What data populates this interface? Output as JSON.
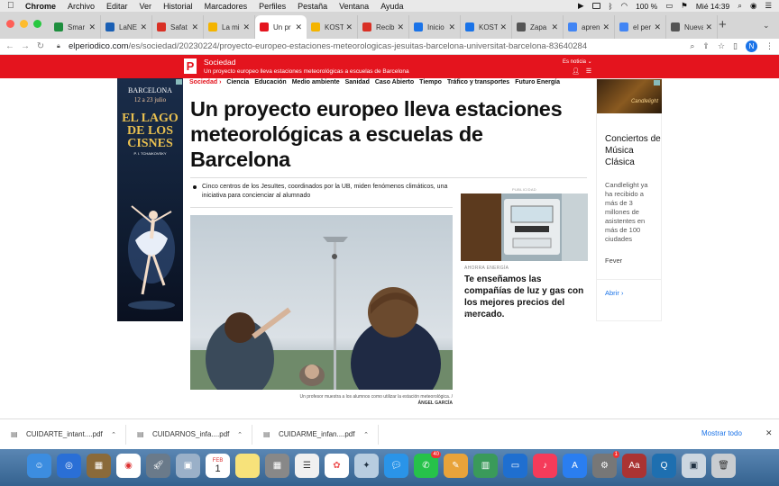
{
  "menubar": {
    "app": "Chrome",
    "items": [
      "Archivo",
      "Editar",
      "Ver",
      "Historial",
      "Marcadores",
      "Perfiles",
      "Pestaña",
      "Ventana",
      "Ayuda"
    ],
    "battery": "100 %",
    "clock": "Mié 14:39"
  },
  "tabs": [
    {
      "label": "Smar",
      "color": "#1e8e3e"
    },
    {
      "label": "LaNE",
      "color": "#1a5fb4"
    },
    {
      "label": "Safat",
      "color": "#d93025"
    },
    {
      "label": "La mi",
      "color": "#f4b400"
    },
    {
      "label": "Un pr",
      "color": "#e4141e",
      "active": true
    },
    {
      "label": "KOST",
      "color": "#f4b400"
    },
    {
      "label": "Recib",
      "color": "#d93025"
    },
    {
      "label": "Inicio",
      "color": "#1a73e8"
    },
    {
      "label": "KOST",
      "color": "#1a73e8"
    },
    {
      "label": "Zapa",
      "color": "#555555"
    },
    {
      "label": "apren",
      "color": "#4285f4"
    },
    {
      "label": "el per",
      "color": "#4285f4"
    },
    {
      "label": "Nueva",
      "color": "#555555"
    }
  ],
  "address": {
    "domain": "elperiodico.com",
    "path": "/es/sociedad/20230224/proyecto-europeo-estaciones-meteorologicas-jesuitas-barcelona-universitat-barcelona-83640284",
    "avatar": "N"
  },
  "site": {
    "logo": "P",
    "section": "Sociedad",
    "subtitle": "Un proyecto europeo lleva estaciones meteorológicas a escuelas de Barcelona",
    "es_noticia": "Es noticia ⌄",
    "brand_color": "#e4141e"
  },
  "subnav": [
    "Sociedad ›",
    "Ciencia",
    "Educación",
    "Medio ambiente",
    "Sanidad",
    "Caso Abierto",
    "Tiempo",
    "Tráfico y transportes",
    "Futuro Energía"
  ],
  "article": {
    "title": "Un proyecto europeo lleva estaciones meteorológicas a escuelas de Barcelona",
    "summary": "Cinco centros de los Jesuïtes, coordinados por la UB, miden fenómenos climáticos, una iniciativa para concienciar al alumnado",
    "caption": "Un profesor muestra a los alumnos como utilizar la estación meteorológica. /",
    "credit": "ÁNGEL GARCÍA"
  },
  "ad_left": {
    "city": "BARCELONA",
    "dates": "12 a 23 julio",
    "show": "EL LAGO DE LOS CISNES",
    "composer": "P. I. TCHAIKOVSKY"
  },
  "ad_right": {
    "brand": "Candlelight",
    "title": "Conciertos de Música Clásica",
    "body": "Candlelight ya ha recibido a más de 3 millones de asistentes en más de 100 ciudades",
    "sponsor": "Fever",
    "cta": "Abrir"
  },
  "sponsored": {
    "label": "PUBLICIDAD",
    "kicker": "AHORRA ENERGÍA",
    "title": "Te enseñamos las compañías de luz y gas con los mejores precios del mercado.",
    "anuncio": "Anuncio"
  },
  "downloads": {
    "files": [
      "CUIDARTE_intant....pdf",
      "CUIDARNOS_infa....pdf",
      "CUIDARME_infan....pdf"
    ],
    "show_all": "Mostrar todo"
  },
  "calendar": {
    "month": "FEB",
    "day": "1"
  },
  "badges": {
    "whatsapp": "40",
    "settings": "1"
  }
}
